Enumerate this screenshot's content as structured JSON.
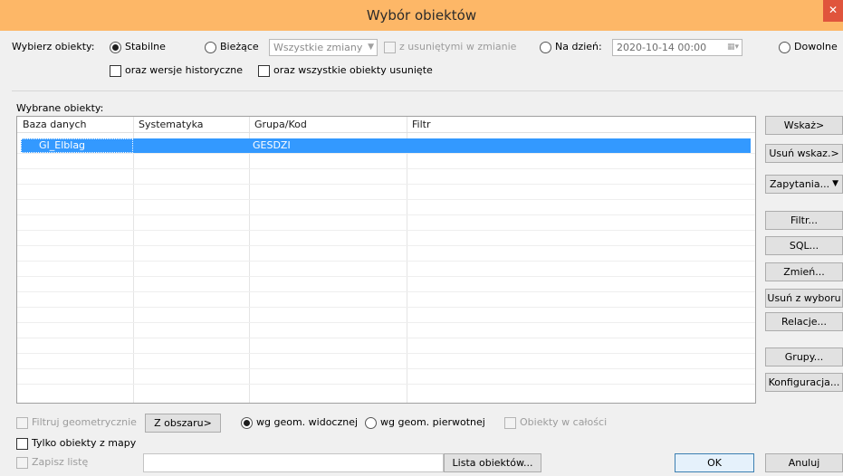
{
  "window": {
    "title": "Wybór obiektów",
    "close_glyph": "✕"
  },
  "selection": {
    "label": "Wybierz obiekty:",
    "mode_stable": "Stabilne",
    "mode_current": "Bieżące",
    "changes_combo": "Wszystkie zmiany",
    "with_deleted_in_change": "z usuniętymi w zmianie",
    "mode_on_date": "Na dzień:",
    "date_value": "2020-10-14 00:00",
    "mode_any": "Dowolne",
    "historical_versions": "oraz wersje historyczne",
    "all_deleted": "oraz wszystkie obiekty usunięte",
    "selected_mode": "Stabilne"
  },
  "grid": {
    "caption": "Wybrane obiekty:",
    "columns": [
      "Baza danych",
      "Systematyka",
      "Grupa/Kod",
      "Filtr"
    ],
    "rows": [
      {
        "database": "GI_Elblag",
        "systematics": "",
        "group_code": "GESDZI",
        "filter": ""
      }
    ]
  },
  "side_buttons": {
    "show": "Wskaż>",
    "remove_shown": "Usuń wskaz.>",
    "queries": "Zapytania...",
    "queries_arrow": "▼",
    "filter": "Filtr...",
    "sql": "SQL...",
    "change": "Zmień...",
    "remove_from_selection": "Usuń z wyboru",
    "relations": "Relacje...",
    "groups": "Grupy...",
    "configuration": "Konfiguracja..."
  },
  "bottom": {
    "filter_geometric": "Filtruj geometrycznie",
    "from_area": "Z obszaru>",
    "by_visible_geom": "wg geom. widocznej",
    "by_original_geom": "wg geom. pierwotnej",
    "whole_objects": "Obiekty w całości",
    "map_objects_only": "Tylko obiekty z mapy",
    "save_list": "Zapisz listę",
    "object_list": "Lista obiektów...",
    "ok": "OK",
    "cancel": "Anuluj"
  },
  "colors": {
    "accent_title": "#fdb767",
    "selection": "#3399ff",
    "close": "#e0543c"
  }
}
